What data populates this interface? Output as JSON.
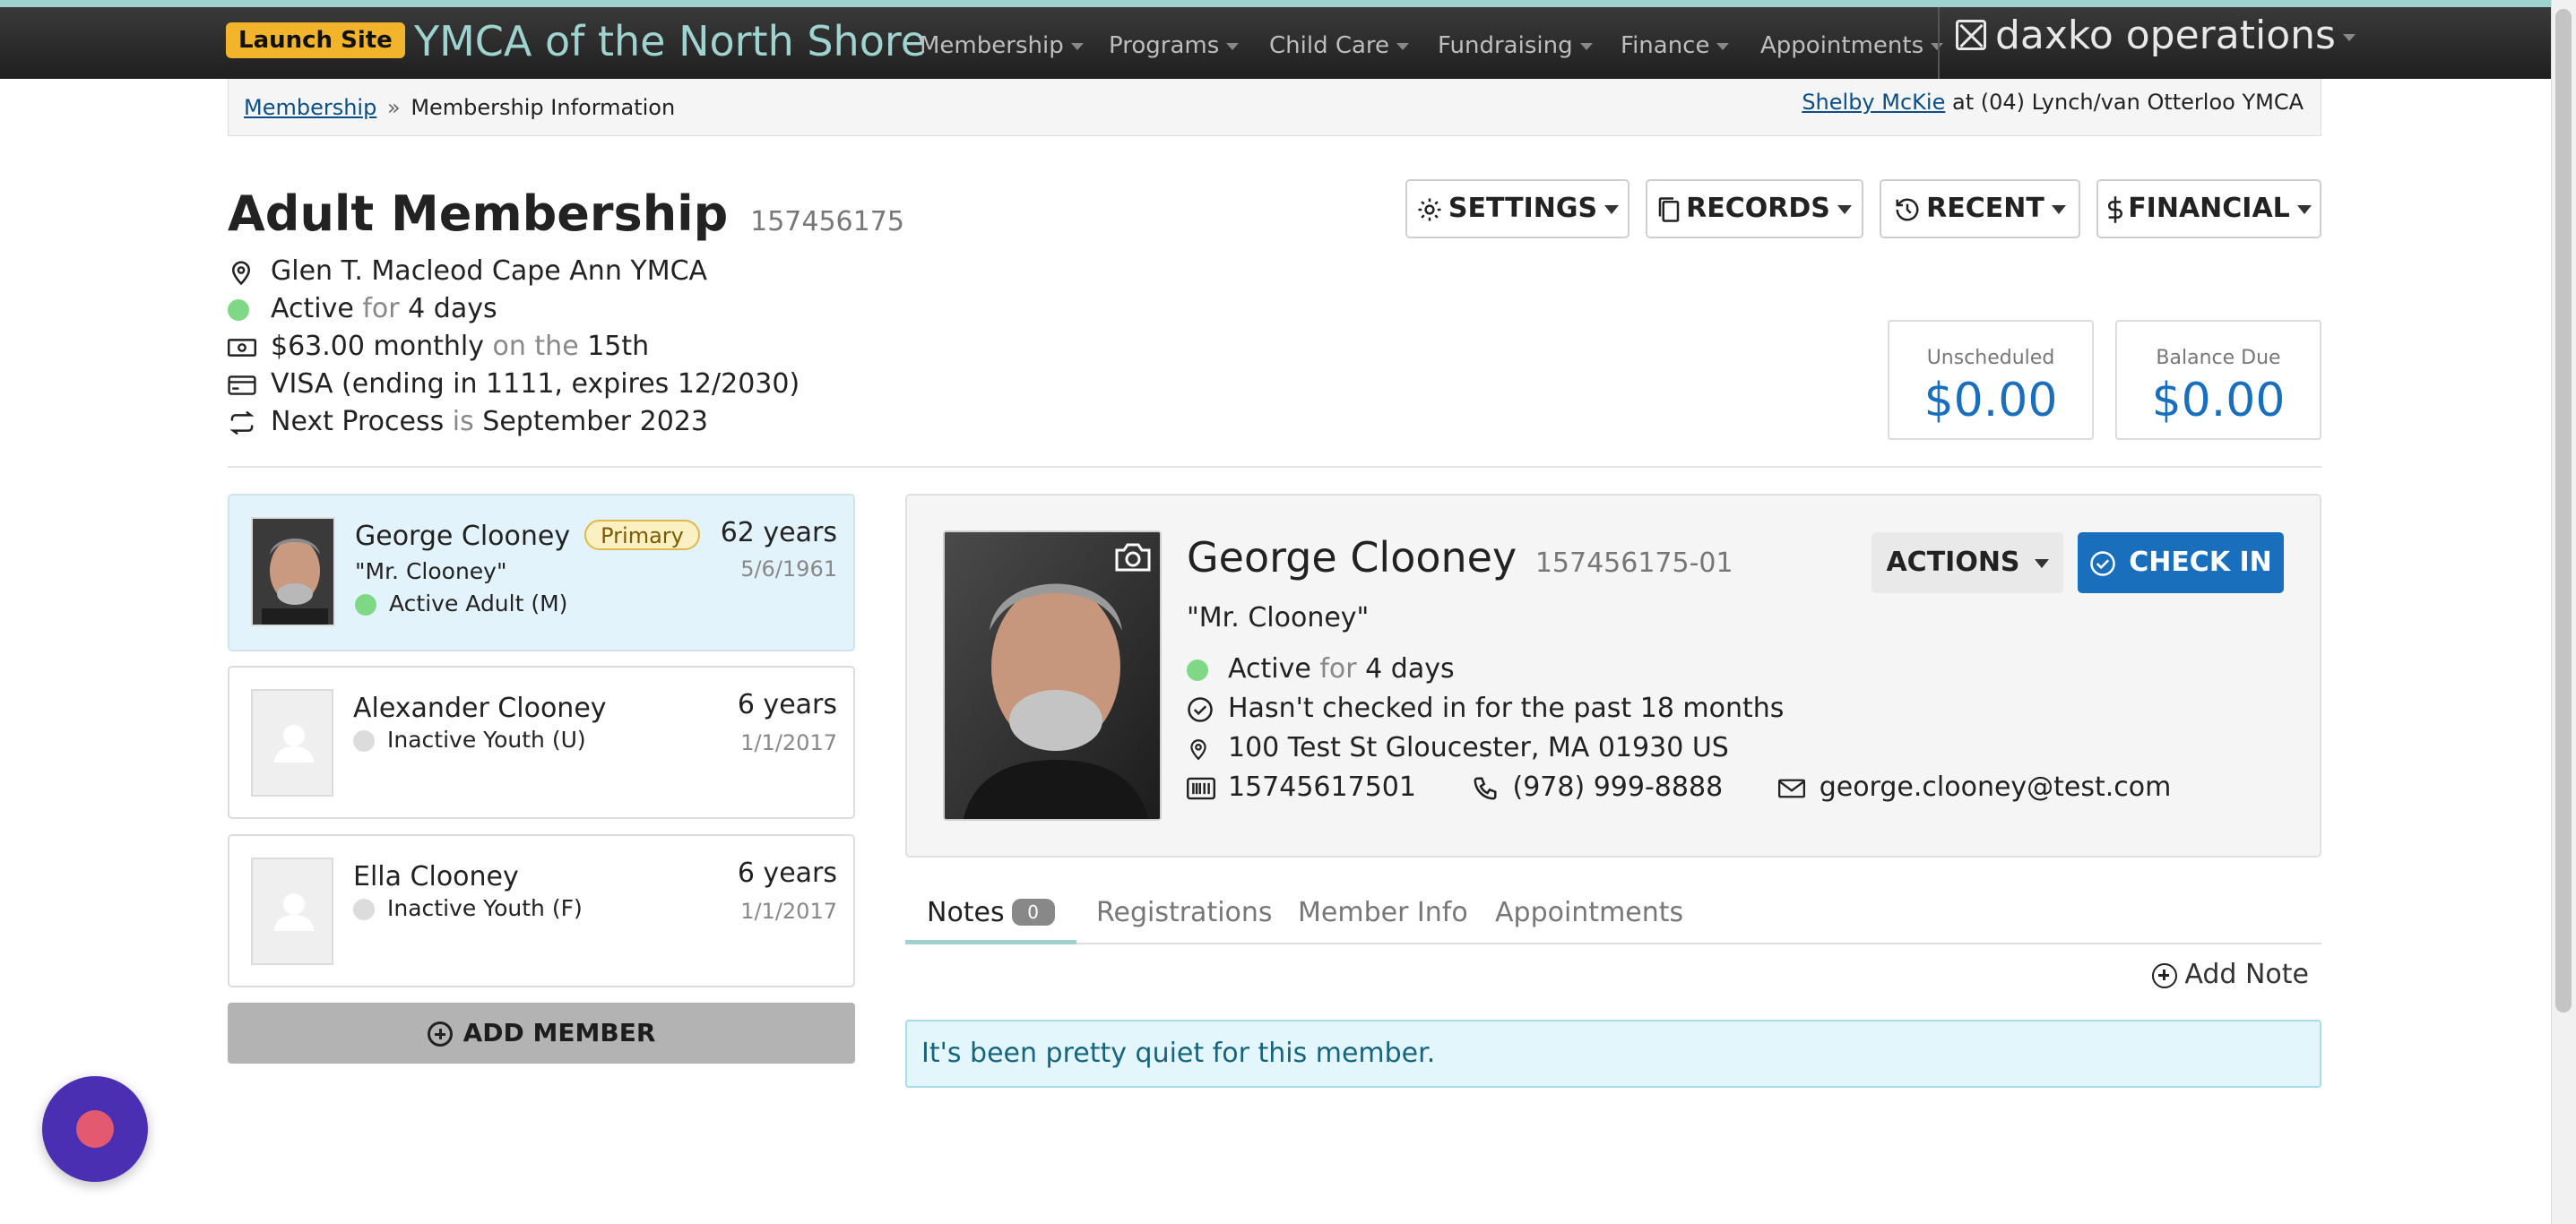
{
  "navbar": {
    "launch_label": "Launch Site",
    "site_name": "YMCA of the North Shore",
    "menu": [
      "Membership",
      "Programs",
      "Child Care",
      "Fundraising",
      "Finance",
      "Appointments"
    ],
    "brand": "daxko operations"
  },
  "breadcrumb": {
    "parent": "Membership",
    "separator": "»",
    "current": "Membership Information"
  },
  "user": {
    "name": "Shelby McKie",
    "location": "at (04) Lynch/van Otterloo YMCA"
  },
  "membership": {
    "title": "Adult Membership",
    "id": "157456175",
    "branch": "Glen T. Macleod Cape Ann YMCA",
    "status_word": "Active",
    "status_for": "for",
    "status_duration": "4 days",
    "price": "$63.00 monthly",
    "price_on": "on the",
    "price_day": "15th",
    "payment": "VISA (ending in 1111, expires 12/2030)",
    "next_label": "Next Process",
    "next_is": "is",
    "next_value": "September 2023"
  },
  "toolbar": {
    "settings": "SETTINGS",
    "records": "RECORDS",
    "recent": "RECENT",
    "financial": "FINANCIAL"
  },
  "balances": {
    "unscheduled_label": "Unscheduled",
    "unscheduled_value": "$0.00",
    "balance_label": "Balance Due",
    "balance_value": "$0.00"
  },
  "members": [
    {
      "name": "George Clooney",
      "badge": "Primary",
      "nickname": "\"Mr. Clooney\"",
      "status": "Active Adult (M)",
      "age": "62 years",
      "dob": "5/6/1961"
    },
    {
      "name": "Alexander Clooney",
      "status": "Inactive Youth (U)",
      "age": "6 years",
      "dob": "1/1/2017"
    },
    {
      "name": "Ella Clooney",
      "status": "Inactive Youth (F)",
      "age": "6 years",
      "dob": "1/1/2017"
    }
  ],
  "add_member_label": "ADD MEMBER",
  "detail": {
    "name": "George Clooney",
    "id": "157456175-01",
    "nickname": "\"Mr. Clooney\"",
    "status_word": "Active",
    "status_for": "for",
    "status_duration": "4 days",
    "checkin_note": "Hasn't checked in for the past 18 months",
    "address": "100 Test St Gloucester, MA 01930 US",
    "barcode": "15745617501",
    "phone": "(978) 999-8888",
    "email": "george.clooney@test.com",
    "actions_label": "ACTIONS",
    "checkin_label": "CHECK IN"
  },
  "tabs": [
    {
      "label": "Notes",
      "count": "0"
    },
    {
      "label": "Registrations"
    },
    {
      "label": "Member Info"
    },
    {
      "label": "Appointments"
    }
  ],
  "add_note_label": "Add Note",
  "empty_message": "It's been pretty quiet for this member.",
  "colors": {
    "accent": "#9fd3cf",
    "primary_blue": "#1a6fbc",
    "launch": "#f2b42a",
    "active_green": "#7fd886",
    "chat_purple": "#4b2fb2"
  }
}
